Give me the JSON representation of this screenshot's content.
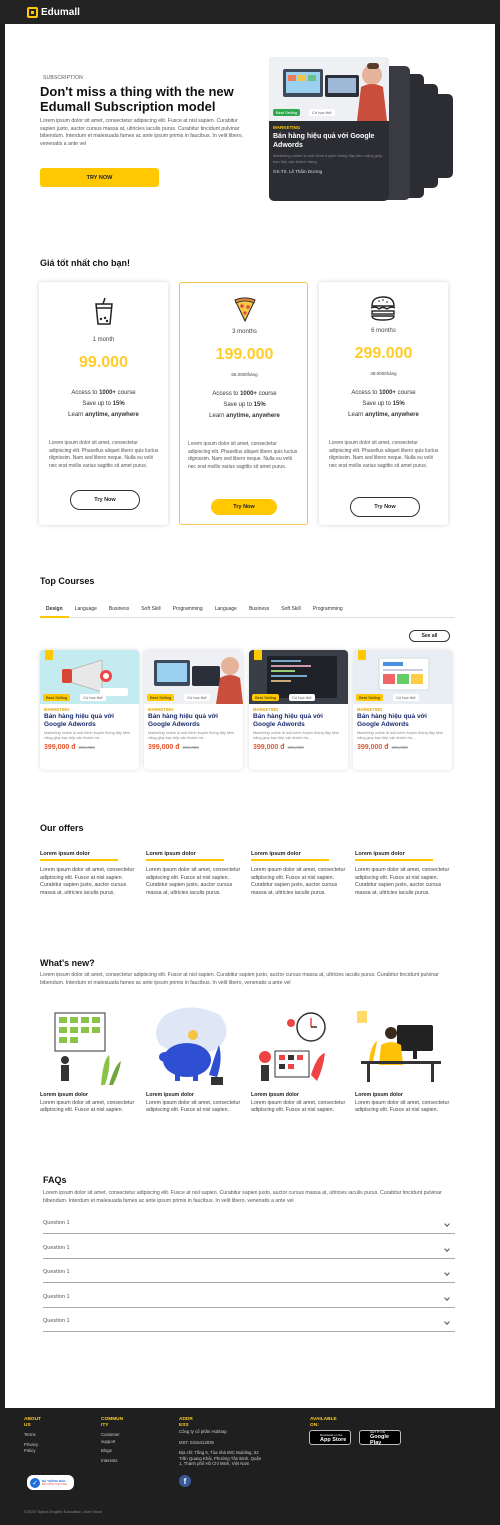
{
  "app": {
    "name": "Edumall"
  },
  "hero": {
    "kicker": "SUBSCRIPTION",
    "title": "Don't miss a thing with the new Edumall Subscription model",
    "desc": "Lorem ipsum dolor sit amet, consectetur adipiscing elit. Fusce at nisl sapien. Curabitur sapien justo, auctor cursus massa at, ultricies iaculis purus. Curabitur tincidunt pulvinar bibendum. Interdum et malesuada fames ac ante ipsum primis in faucibus. In velit libero, venenatis a ante vel",
    "cta": "TRY NOW",
    "card": {
      "badge": "Best Selling",
      "trial": "Có học thử",
      "category": "MARKETING",
      "title": "Bán hàng hiệu quả với Google Adwords",
      "desc": "Marketing online là một kênh truyền thông đầy tiềm năng giúp bạn tiếp cận khách hàng",
      "author": "GS.TS. Lê Thẩm Dương"
    }
  },
  "pricing": {
    "title": "Giá tốt nhất cho bạn!",
    "plans": [
      {
        "period": "1 month",
        "price": "99.000",
        "per": "",
        "line1_pre": "Access to ",
        "line1_bold": "1000+",
        "line1_post": " course",
        "line2_pre": "Save up to ",
        "line2_bold": "15%",
        "line3_pre": "Learn ",
        "line3_bold": "anytime, anywhere",
        "desc": "Lorem ipsum dolor sit amet, consectetur adipiscing elit. Phasellus aliquet libero quis luctus dignissim. Nam sed libero neque. Nulla eu velit nec erat mollis varius sagittis sit amet purus.",
        "button": "Try Now",
        "icon": "bubble-tea-icon"
      },
      {
        "period": "3 months",
        "price": "199.000",
        "per": "66.000/tháng",
        "line1_pre": "Access to ",
        "line1_bold": "1000+",
        "line1_post": " course",
        "line2_pre": "Save up to ",
        "line2_bold": "15%",
        "line3_pre": "Learn ",
        "line3_bold": "anytime, anywhere",
        "desc": "Lorem ipsum dolor sit amet, consectetur adipiscing elit. Phasellus aliquet libero quis luctus dignissim. Nam sed libero neque. Nulla eu velit nec erat mollis varius sagittis sit amet purus.",
        "button": "Try Now",
        "icon": "pizza-icon"
      },
      {
        "period": "6 months",
        "price": "299.000",
        "per": "49.000/tháng",
        "line1_pre": "Access to ",
        "line1_bold": "1000+",
        "line1_post": " course",
        "line2_pre": "Save up to ",
        "line2_bold": "15%",
        "line3_pre": "Learn ",
        "line3_bold": "anytime, anywhere",
        "desc": "Lorem ipsum dolor sit amet, consectetur adipiscing elit. Phasellus aliquet libero quis luctus dignissim. Nam sed libero neque. Nulla eu velit nec erat mollis varius sagittis sit amet purus.",
        "button": "Try Now",
        "icon": "burger-icon"
      }
    ]
  },
  "courses": {
    "title": "Top Courses",
    "tabs": [
      "Design",
      "Language",
      "Business",
      "Soft Skill",
      "Programming",
      "Language",
      "Business",
      "Soft Skill",
      "Programming"
    ],
    "see_all": "See all",
    "items": [
      {
        "badge": "Best Selling",
        "trial": "Có học thử",
        "category": "MARKETING",
        "title": "Bán hàng hiệu quả với Google Adwords",
        "desc": "Marketing online là một kênh truyền thông đầy tiềm năng giúp bạn tiếp cận khách hà...",
        "price": "399,000 đ",
        "old_price": "999,000",
        "bookmark": true
      },
      {
        "badge": "Best Selling",
        "trial": "Có học thử",
        "category": "MARKETING",
        "title": "Bán hàng hiệu quả với Google Adwords",
        "desc": "Marketing online là một kênh truyền thông đầy tiềm năng giúp bạn tiếp cận khách hà...",
        "price": "399,000 đ",
        "old_price": "999,000",
        "bookmark": false
      },
      {
        "badge": "Best Selling",
        "trial": "Có học thử",
        "category": "MARKETING",
        "title": "Bán hàng hiệu quả với Google Adwords",
        "desc": "Marketing online là một kênh truyền thông đầy tiềm năng giúp bạn tiếp cận khách hà...",
        "price": "399,000 đ",
        "old_price": "999,000",
        "bookmark": true
      },
      {
        "badge": "Best Selling",
        "trial": "Có học thử",
        "category": "MARKETING",
        "title": "Bán hàng hiệu quả với Google Adwords",
        "desc": "Marketing online là một kênh truyền thông đầy tiềm năng giúp bạn tiếp cận khách hà...",
        "price": "399,000 đ",
        "old_price": "999,000",
        "bookmark": true
      }
    ]
  },
  "offers": {
    "title": "Our offers",
    "items": [
      {
        "heading": "Lorem ipsum dolor",
        "text": "Lorem ipsum dolor sit amet, consectetur adipiscing elit. Fusce at nisl sapien. Curabitur sapien justo, auctor cursus massa at, ultricies iaculis purus."
      },
      {
        "heading": "Lorem ipsum dolor",
        "text": "Lorem ipsum dolor sit amet, consectetur adipiscing elit. Fusce at nisl sapien. Curabitur sapien justo, auctor cursus massa at, ultricies iaculis purus."
      },
      {
        "heading": "Lorem ipsum dolor",
        "text": "Lorem ipsum dolor sit amet, consectetur adipiscing elit. Fusce at nisl sapien. Curabitur sapien justo, auctor cursus massa at, ultricies iaculis purus."
      },
      {
        "heading": "Lorem ipsum dolor",
        "text": "Lorem ipsum dolor sit amet, consectetur adipiscing elit. Fusce at nisl sapien. Curabitur sapien justo, auctor cursus massa at, ultricies iaculis purus."
      }
    ]
  },
  "news": {
    "title": "What's new?",
    "desc": "Lorem ipsum dolor sit amet, consectetur adipiscing elit. Fusce at nisl sapien. Curabitur sapien justo, auctor cursus massa at, ultricies iaculis purus. Curabitur tincidunt pulvinar bibendum. Interdum et malesuada fames ac ante ipsum primis in faucibus. In velit libero, venenatis a ante vel",
    "items": [
      {
        "heading": "Lorem ipsum dolor",
        "text": "Lorem ipsum dolor sit amet, consectetur adipiscing elit. Fusce at nisl sapien."
      },
      {
        "heading": "Lorem ipsum dolor",
        "text": "Lorem ipsum dolor sit amet, consectetur adipiscing elit. Fusce at nisl sapien."
      },
      {
        "heading": "Lorem ipsum dolor",
        "text": "Lorem ipsum dolor sit amet, consectetur adipiscing elit. Fusce at nisl sapien."
      },
      {
        "heading": "Lorem ipsum dolor",
        "text": "Lorem ipsum dolor sit amet, consectetur adipiscing elit. Fusce at nisl sapien."
      }
    ]
  },
  "faqs": {
    "title": "FAQs",
    "desc": "Lorem ipsum dolor sit amet, consectetur adipiscing elit. Fusce at nisl sapien. Curabitur sapien justo, auctor cursus massa at, ultricies iaculis purus. Curabitur tincidunt pulvinar bibendum. Interdum et malesuada fames ac ante ipsum primis in faucibus. In velit libero, venenatis a ante vel",
    "questions": [
      "Question 1",
      "Question 1",
      "Question 1",
      "Question 1",
      "Question 1"
    ]
  },
  "footer": {
    "about": {
      "heading_1": "ABOUT",
      "heading_2": "US",
      "links": [
        "Terms",
        "Privacy",
        "Policy"
      ]
    },
    "community": {
      "heading_1": "COMMUN",
      "heading_2": "ITY",
      "links": [
        "Customer",
        "support",
        "Blogs",
        "Interests"
      ]
    },
    "address": {
      "heading_1": "ADDR",
      "heading_2": "ESS",
      "company": "Công ty cổ phần Hubtrap",
      "mst": "MST: 0316413035",
      "addr_1": "Địa chỉ: Tầng 6, Tòa nhà IMC Building, 62",
      "addr_2": "Trần Quang Khải, Phường Tân Định, Quận",
      "addr_3": "1, Thành phố Hồ Chí Minh, Việt Nam"
    },
    "available": {
      "heading_1": "AVAILABLE",
      "heading_2": "ON:",
      "app_store_small": "Download on the",
      "app_store": "App Store",
      "google_play_small": "GET IT ON",
      "google_play": "Google Play"
    },
    "registered": {
      "line1": "ĐÃ THÔNG BÁO",
      "line2": "BỘ CÔNG THƯƠNG"
    },
    "copyright": "©2020 Topica English Education Joint Stock"
  },
  "colors": {
    "accent": "#ffc800",
    "price": "#ffcc2a",
    "sale": "#e4572e",
    "dark": "#2c2d33",
    "navy": "#1a2b6d"
  }
}
